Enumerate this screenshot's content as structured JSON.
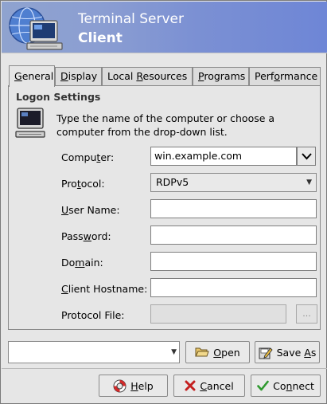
{
  "banner": {
    "title_line1": "Terminal Server",
    "title_line2": "Client",
    "icon": "computer-globe-icon"
  },
  "tabs": [
    {
      "label_pre": "",
      "label_u": "G",
      "label_post": "eneral",
      "active": true
    },
    {
      "label_pre": "",
      "label_u": "D",
      "label_post": "isplay",
      "active": false
    },
    {
      "label_pre": "Local ",
      "label_u": "R",
      "label_post": "esources",
      "active": false
    },
    {
      "label_pre": "",
      "label_u": "P",
      "label_post": "rograms",
      "active": false
    },
    {
      "label_pre": "Perf",
      "label_u": "o",
      "label_post": "rmance",
      "active": false
    }
  ],
  "logon": {
    "section_title": "Logon Settings",
    "info_text": "Type the name of the computer or choose a computer from the drop-down list.",
    "computer": {
      "pre": "Compu",
      "u": "t",
      "post": "er:",
      "value": "win.example.com"
    },
    "protocol": {
      "pre": "Pro",
      "u": "t",
      "post": "ocol:",
      "value": "RDPv5"
    },
    "username": {
      "pre": "",
      "u": "U",
      "post": "ser Name:",
      "value": ""
    },
    "password": {
      "pre": "Pass",
      "u": "w",
      "post": "ord:",
      "value": ""
    },
    "domain": {
      "pre": "Do",
      "u": "m",
      "post": "ain:",
      "value": ""
    },
    "hostname": {
      "pre": "",
      "u": "C",
      "post": "lient Hostname:",
      "value": ""
    },
    "protocol_file": {
      "pre": "Protocol File:",
      "u": "",
      "post": "",
      "value": "",
      "browse": "..."
    }
  },
  "footer": {
    "profile_value": "",
    "open": {
      "pre": "",
      "u": "O",
      "post": "pen"
    },
    "save_as": {
      "pre": "Save ",
      "u": "A",
      "post": "s"
    },
    "help": {
      "pre": "",
      "u": "H",
      "post": "elp"
    },
    "cancel": {
      "pre": "",
      "u": "C",
      "post": "ancel"
    },
    "connect": {
      "pre": "Co",
      "u": "n",
      "post": "nect"
    }
  },
  "colors": {
    "banner_start": "#8fa3cf",
    "banner_end": "#6e86d6",
    "window_bg": "#e6e6e6"
  }
}
